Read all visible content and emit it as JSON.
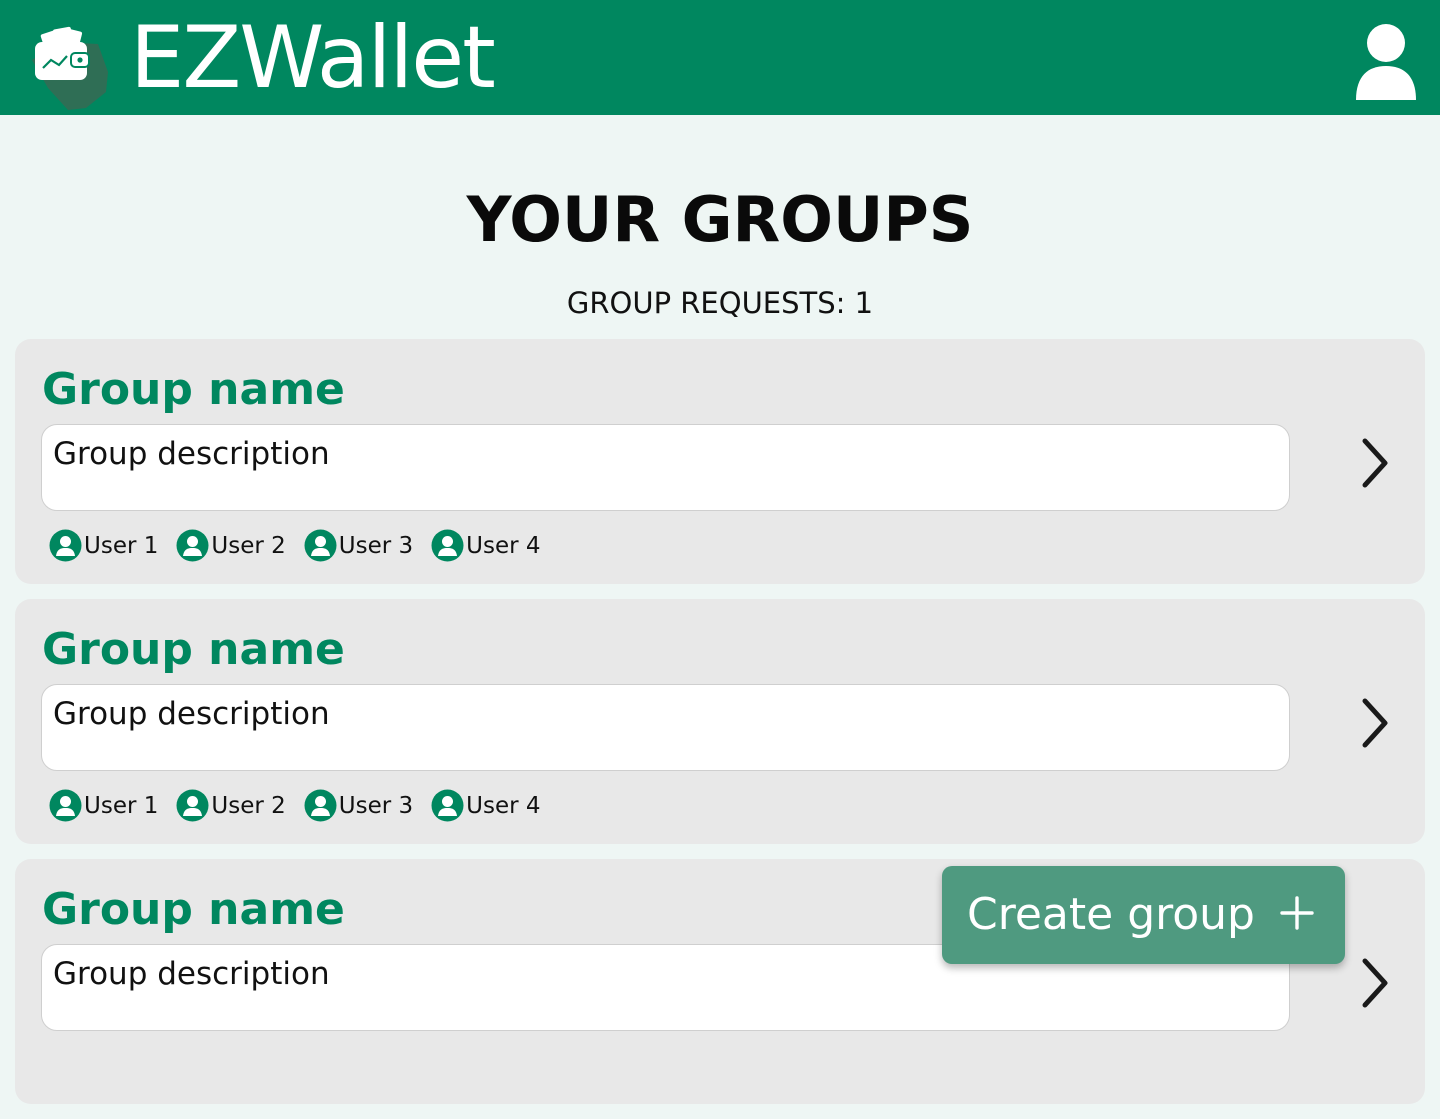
{
  "header": {
    "app_name": "EZWallet",
    "colors": {
      "brand": "#00875f",
      "logo_shadow": "#2f6e55"
    },
    "logo_icon": "wallet-icon",
    "profile_icon": "user-profile-icon"
  },
  "main": {
    "title": "YOUR GROUPS",
    "group_requests": "GROUP REQUESTS: 1",
    "groups": [
      {
        "name": "Group name",
        "description": "Group description",
        "members": [
          "User 1",
          "User 2",
          "User 3",
          "User 4"
        ]
      },
      {
        "name": "Group name",
        "description": "Group description",
        "members": [
          "User 1",
          "User 2",
          "User 3",
          "User 4"
        ]
      },
      {
        "name": "Group name",
        "description": "Group description",
        "members": []
      }
    ],
    "create_button": {
      "label": "Create group",
      "icon": "plus-icon",
      "color": "#4f9a80"
    }
  }
}
